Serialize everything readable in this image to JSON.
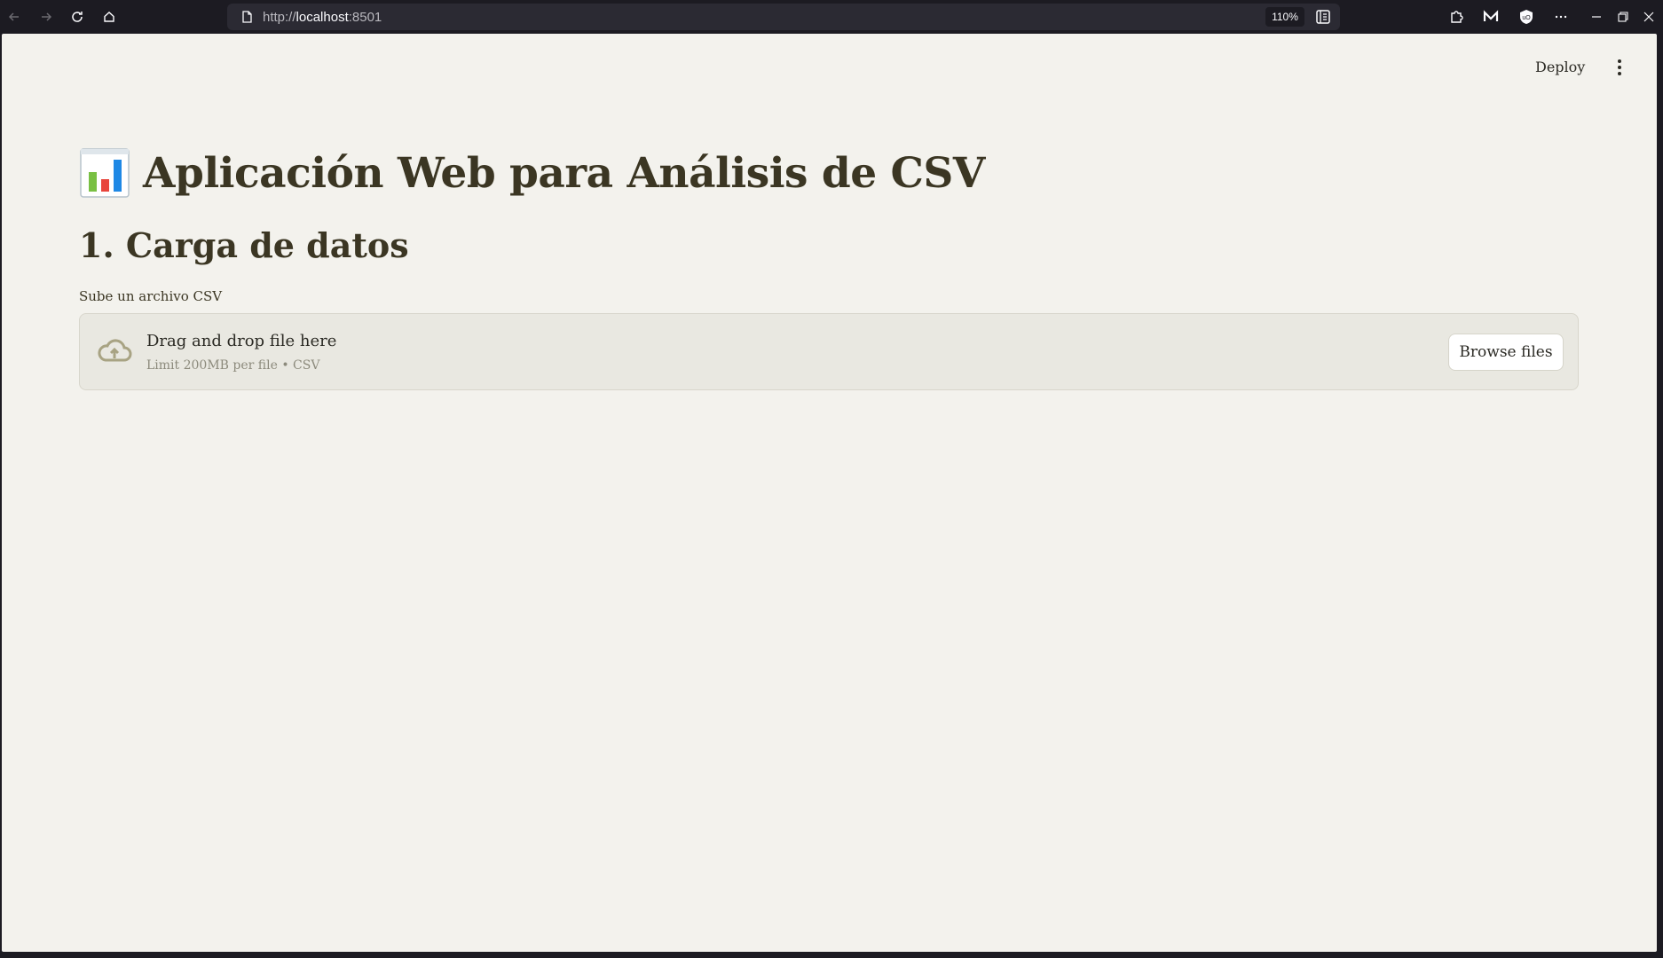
{
  "browser": {
    "url_scheme": "http://",
    "url_host": "localhost",
    "url_port": ":8501",
    "zoom": "110%",
    "icons": {
      "back": "arrow-left-icon",
      "forward": "arrow-right-icon",
      "reload": "reload-icon",
      "home": "home-icon",
      "page": "page-icon",
      "reader": "reader-view-icon",
      "extensions": [
        "puzzle-icon",
        "m-extension-icon",
        "shield-extension-icon"
      ],
      "overflow": "more-icon"
    }
  },
  "app": {
    "deploy_label": "Deploy",
    "title": "Aplicación Web para Análisis de CSV",
    "title_icon": "bar-chart-emoji-icon",
    "section_heading": "1. Carga de datos",
    "uploader": {
      "label": "Sube un archivo CSV",
      "drop_text": "Drag and drop file here",
      "limit_text": "Limit 200MB per file • CSV",
      "browse_label": "Browse files",
      "icon": "cloud-upload-icon"
    }
  },
  "colors": {
    "background": "#f3f2ed",
    "text": "#3b3623",
    "dropzone": "#e9e8e1",
    "icon_muted": "#a8a383"
  }
}
